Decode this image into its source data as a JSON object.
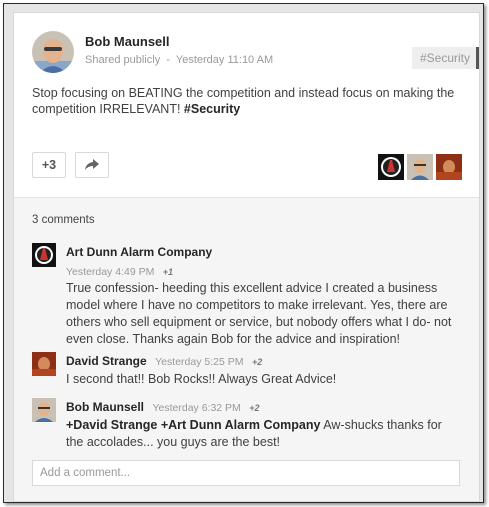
{
  "post": {
    "author": "Bob Maunsell",
    "visibility": "Shared publicly",
    "separator": "-",
    "timestamp": "Yesterday 11:10 AM",
    "tag_chip": "#Security",
    "text": "Stop focusing on BEATING the competition and instead focus on making the competition IRRELEVANT!",
    "hashtag": "#Security",
    "plus_label": "+3",
    "share_icon": "share-arrow-icon"
  },
  "comments_section": {
    "count_label": "3 comments",
    "comments": [
      {
        "author": "Art Dunn Alarm Company",
        "time": "Yesterday 4:49 PM",
        "plus": "+1",
        "text": "True confession- heeding this excellent advice I created a business model where I have no competitors to make irrelevant. Yes, there are others who sell equipment or service, but nobody offers what I do- not even close. Thanks again Bob for the advice and inspiration!"
      },
      {
        "author": "David Strange",
        "time": "Yesterday 5:25 PM",
        "plus": "+2",
        "text": "I second that!! Bob Rocks!! Always Great Advice!"
      },
      {
        "author": "Bob Maunsell",
        "time": "Yesterday 6:32 PM",
        "plus": "+2",
        "mention1": "+David Strange",
        "mention2": "+Art Dunn Alarm Company",
        "text": "Aw-shucks thanks for the accolades... you guys are the best!"
      }
    ],
    "add_comment_placeholder": "Add a comment..."
  },
  "colors": {
    "accent_dark": "#262626",
    "muted": "#999999",
    "comments_bg": "#f5f5f5"
  }
}
